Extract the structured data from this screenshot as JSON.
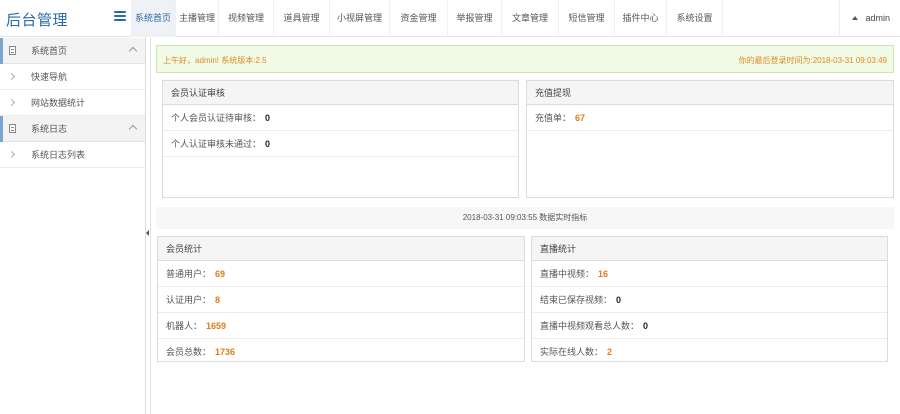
{
  "app": {
    "title": "后台管理"
  },
  "nav": {
    "items": [
      {
        "label": "系统首页",
        "active": true
      },
      {
        "label": "主播管理",
        "active": false
      },
      {
        "label": "视频管理",
        "active": false
      },
      {
        "label": "道具管理",
        "active": false
      },
      {
        "label": "小视屏管理",
        "active": false
      },
      {
        "label": "资金管理",
        "active": false
      },
      {
        "label": "举报管理",
        "active": false
      },
      {
        "label": "文章管理",
        "active": false
      },
      {
        "label": "短信管理",
        "active": false
      },
      {
        "label": "插件中心",
        "active": false
      },
      {
        "label": "系统设置",
        "active": false
      }
    ],
    "user": "admin"
  },
  "sidebar": {
    "group1": {
      "label": "系统首页"
    },
    "group1_items": [
      {
        "label": "快速导航"
      },
      {
        "label": "网站数据统计"
      }
    ],
    "group2": {
      "label": "系统日志"
    },
    "group2_items": [
      {
        "label": "系统日志列表"
      }
    ]
  },
  "notice": {
    "greeting": "上午好，admin! 系统版本:2.5",
    "last_login": "你的最后登录时间为:2018-03-31 09:03:49"
  },
  "member_verify": {
    "title": "会员认证审核",
    "pending_label": "个人会员认证待审核：",
    "pending_value": "0",
    "rejected_label": "个人认证审核未通过：",
    "rejected_value": "0"
  },
  "recharge": {
    "title": "充值提现",
    "orders_label": "充值单：",
    "orders_value": "67"
  },
  "realtime": {
    "text": "2018-03-31 09:03:55 数据实时指标"
  },
  "member_stats": {
    "title": "会员统计",
    "rows": [
      {
        "label": "普通用户：",
        "value": "69"
      },
      {
        "label": "认证用户：",
        "value": "8"
      },
      {
        "label": "机器人：",
        "value": "1659"
      },
      {
        "label": "会员总数：",
        "value": "1736"
      }
    ]
  },
  "live_stats": {
    "title": "直播统计",
    "rows": [
      {
        "label": "直播中视频：",
        "value": "16",
        "color": "orange"
      },
      {
        "label": "结束已保存视频：",
        "value": "0",
        "color": "dark"
      },
      {
        "label": "直播中视频观看总人数：",
        "value": "0",
        "color": "dark"
      },
      {
        "label": "实际在线人数：",
        "value": "2",
        "color": "orange"
      }
    ]
  },
  "colors": {
    "accent": "#2a6aa8",
    "highlight": "#e07b1a",
    "notice_bg": "#f1fae6"
  }
}
